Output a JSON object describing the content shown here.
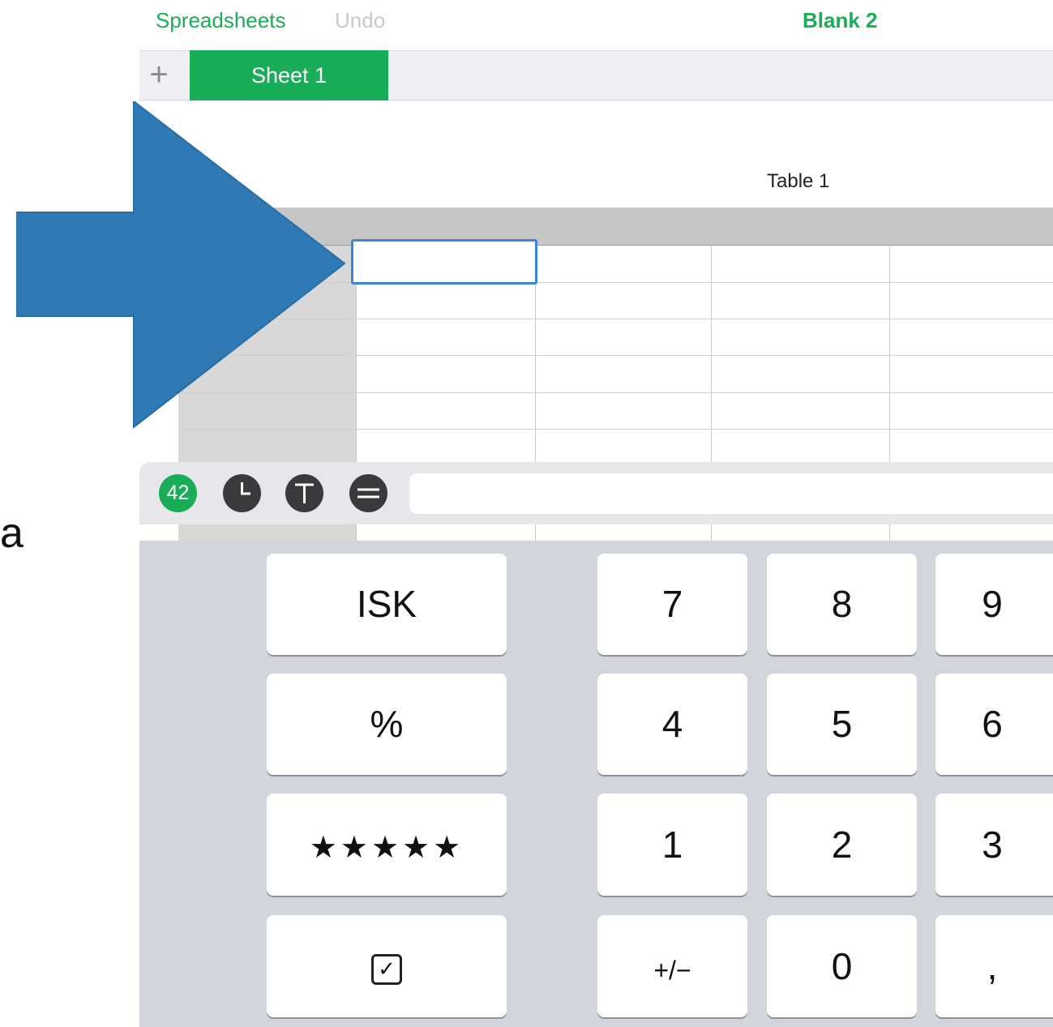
{
  "nav": {
    "back_label": "Spreadsheets",
    "undo_label": "Undo",
    "title": "Blank 2"
  },
  "tabs": {
    "add_icon": "plus-icon",
    "add_symbol": "+",
    "items": [
      {
        "label": "Sheet 1",
        "active": true
      }
    ]
  },
  "table": {
    "title": "Table 1"
  },
  "format_bar": {
    "number_label": "42",
    "buttons": [
      "number-format",
      "date-time-format",
      "text-format",
      "formula-format"
    ],
    "input_value": ""
  },
  "side_text": "a",
  "keypad": {
    "wide_keys": [
      "ISK",
      "%",
      "★★★★★"
    ],
    "digits": {
      "row1": [
        "7",
        "8",
        "9"
      ],
      "row2": [
        "4",
        "5",
        "6"
      ],
      "row3": [
        "1",
        "2",
        "3"
      ],
      "row4": [
        "+/−",
        "0",
        ","
      ]
    },
    "checkbox_symbol": "✓"
  },
  "colors": {
    "accent": "#1aad57",
    "arrow": "#2f7ab5",
    "selection": "#3a86d8"
  }
}
